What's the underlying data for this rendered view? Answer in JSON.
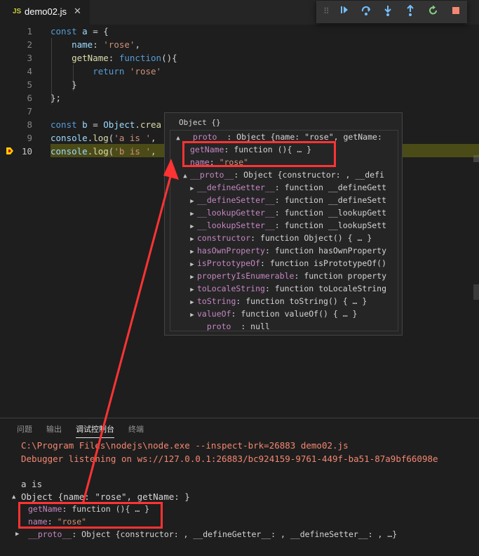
{
  "tab": {
    "lang": "JS",
    "filename": "demo02.js",
    "close": "✕"
  },
  "debug_toolbar": {
    "buttons": [
      "continue",
      "step-over",
      "step-into",
      "step-out",
      "restart",
      "stop"
    ]
  },
  "editor": {
    "line_numbers": [
      "1",
      "2",
      "3",
      "4",
      "5",
      "6",
      "7",
      "8",
      "9",
      "10"
    ],
    "lines": [
      [
        {
          "t": "const ",
          "c": "kw"
        },
        {
          "t": "a",
          "c": "prop"
        },
        {
          "t": " = {",
          "c": ""
        }
      ],
      [
        {
          "t": "    ",
          "c": ""
        },
        {
          "t": "name",
          "c": "prop"
        },
        {
          "t": ": ",
          "c": ""
        },
        {
          "t": "'rose'",
          "c": "str"
        },
        {
          "t": ",",
          "c": ""
        }
      ],
      [
        {
          "t": "    ",
          "c": ""
        },
        {
          "t": "getName",
          "c": "fn"
        },
        {
          "t": ": ",
          "c": ""
        },
        {
          "t": "function",
          "c": "kw"
        },
        {
          "t": "(){",
          "c": ""
        }
      ],
      [
        {
          "t": "        ",
          "c": ""
        },
        {
          "t": "return ",
          "c": "kw"
        },
        {
          "t": "'rose'",
          "c": "str"
        }
      ],
      [
        {
          "t": "    }",
          "c": ""
        }
      ],
      [
        {
          "t": "};",
          "c": ""
        }
      ],
      [
        {
          "t": "",
          "c": ""
        }
      ],
      [
        {
          "t": "const ",
          "c": "kw"
        },
        {
          "t": "b",
          "c": "prop"
        },
        {
          "t": " = ",
          "c": ""
        },
        {
          "t": "Object",
          "c": "prop"
        },
        {
          "t": ".",
          "c": ""
        },
        {
          "t": "crea",
          "c": "fn"
        }
      ],
      [
        {
          "t": "console",
          "c": "prop"
        },
        {
          "t": ".",
          "c": ""
        },
        {
          "t": "log",
          "c": "fn"
        },
        {
          "t": "(",
          "c": ""
        },
        {
          "t": "'a is '",
          "c": "str"
        },
        {
          "t": ",",
          "c": ""
        }
      ],
      [
        {
          "t": "console",
          "c": "prop"
        },
        {
          "t": ".",
          "c": ""
        },
        {
          "t": "log",
          "c": "fn"
        },
        {
          "t": "(",
          "c": ""
        },
        {
          "t": "'b is '",
          "c": "str"
        },
        {
          "t": ",",
          "c": ""
        }
      ]
    ],
    "current_line": "10"
  },
  "hover": {
    "title": "Object {}",
    "rows": [
      {
        "k": "__proto__",
        "v": ": Object {name: \"rose\", getName: ",
        "tw": "▲",
        "indent": 0
      },
      {
        "k": "getName",
        "v": ": function (){ … }",
        "tw": "",
        "indent": 1
      },
      {
        "k": "name",
        "v": ": ",
        "s": "\"rose\"",
        "tw": "",
        "indent": 1
      },
      {
        "k": "__proto__",
        "v": ": Object {constructor: , __defi",
        "tw": "▲",
        "indent": 1
      },
      {
        "k": "__defineGetter__",
        "v": ": function __defineGett",
        "tw": "▶",
        "indent": 2
      },
      {
        "k": "__defineSetter__",
        "v": ": function __defineSett",
        "tw": "▶",
        "indent": 2
      },
      {
        "k": "__lookupGetter__",
        "v": ": function __lookupGett",
        "tw": "▶",
        "indent": 2
      },
      {
        "k": "__lookupSetter__",
        "v": ": function __lookupSett",
        "tw": "▶",
        "indent": 2
      },
      {
        "k": "constructor",
        "v": ": function Object() { … }",
        "tw": "▶",
        "indent": 2
      },
      {
        "k": "hasOwnProperty",
        "v": ": function hasOwnProperty",
        "tw": "▶",
        "indent": 2
      },
      {
        "k": "isPrototypeOf",
        "v": ": function isPrototypeOf()",
        "tw": "▶",
        "indent": 2
      },
      {
        "k": "propertyIsEnumerable",
        "v": ": function property",
        "tw": "▶",
        "indent": 2
      },
      {
        "k": "toLocaleString",
        "v": ": function toLocaleString",
        "tw": "▶",
        "indent": 2
      },
      {
        "k": "toString",
        "v": ": function toString() { … }",
        "tw": "▶",
        "indent": 2
      },
      {
        "k": "valueOf",
        "v": ": function valueOf() { … }",
        "tw": "▶",
        "indent": 2
      },
      {
        "k": "__proto__",
        "v": ": null",
        "tw": "",
        "indent": 2
      }
    ]
  },
  "panel": {
    "tabs": [
      "问题",
      "输出",
      "调试控制台",
      "终端"
    ],
    "active_tab": "调试控制台",
    "lines": {
      "cmd": "C:\\Program Files\\nodejs\\node.exe --inspect-brk=26883 demo02.js",
      "listening": "Debugger listening on ws://127.0.0.1:26883/bc924159-9761-449f-ba51-87a9bf66098e",
      "a_is": "a is",
      "object": "Object {name: \"rose\", getName: }",
      "getName_key": "getName",
      "getName_val": ": function (){ … }",
      "name_key": "name",
      "name_val_sep": ": ",
      "name_val": "\"rose\"",
      "proto_key": "__proto__",
      "proto_val": ": Object {constructor: , __defineGetter__: , __defineSetter__: , …}"
    }
  },
  "colors": {
    "annotation": "#ff3333",
    "highlight": "#4b4b18"
  }
}
